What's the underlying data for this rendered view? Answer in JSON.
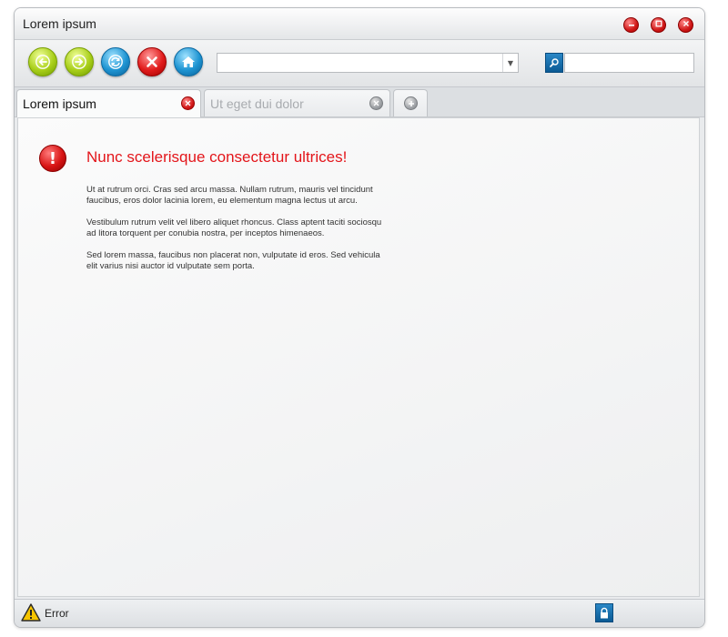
{
  "window": {
    "title": "Lorem ipsum"
  },
  "toolbar": {
    "address_value": "",
    "search_value": ""
  },
  "tabs": [
    {
      "label": "Lorem ipsum",
      "active": true
    },
    {
      "label": "Ut eget dui dolor",
      "active": false
    }
  ],
  "content": {
    "heading": "Nunc scelerisque consectetur ultrices!",
    "paragraphs": [
      "Ut at rutrum orci. Cras sed arcu massa. Nullam rutrum, mauris vel tincidunt faucibus, eros dolor lacinia lorem, eu elementum magna lectus ut arcu.",
      "Vestibulum rutrum velit vel libero aliquet rhoncus. Class aptent taciti sociosqu ad litora torquent per conubia nostra, per inceptos himenaeos.",
      "Sed lorem massa, faucibus non placerat non, vulputate id eros. Sed vehicula elit varius nisi auctor id vulputate sem porta."
    ]
  },
  "statusbar": {
    "text": "Error"
  },
  "icons": {
    "window_controls": [
      "minimize-icon",
      "maximize-icon",
      "close-icon"
    ],
    "nav": [
      "back-arrow-icon",
      "forward-arrow-icon",
      "refresh-icon",
      "stop-icon",
      "home-icon"
    ],
    "search": "magnifier-icon",
    "error": "exclamation-icon",
    "status": [
      "warning-icon",
      "lock-icon"
    ]
  },
  "colors": {
    "nav_green": "#a9cf1a",
    "nav_blue": "#1e94d2",
    "accent_red": "#e3151a",
    "search_blue": "#0b5a94"
  }
}
